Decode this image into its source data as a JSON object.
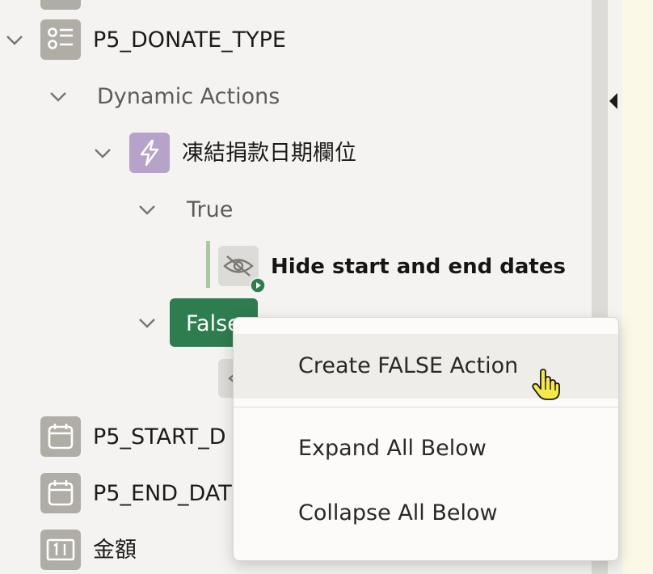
{
  "tree": {
    "item_type": {
      "label": "P5_DONATE_TYPE",
      "icon": "radio-group-icon"
    },
    "dynamic_actions": {
      "label": "Dynamic Actions"
    },
    "da_event": {
      "label": "凍結捐款日期欄位",
      "icon": "lightning-icon"
    },
    "true_branch": {
      "label": "True"
    },
    "hide_action": {
      "label": "Hide start and end dates",
      "icon": "eye-slash-icon"
    },
    "false_branch": {
      "label": "False"
    },
    "start_date": {
      "label": "P5_START_D",
      "icon": "calendar-icon"
    },
    "end_date": {
      "label": "P5_END_DAT",
      "icon": "calendar-icon"
    },
    "amount": {
      "label": "金額",
      "icon": "number-field-icon"
    }
  },
  "context_menu": {
    "items": [
      {
        "label": "Create FALSE Action"
      },
      {
        "label": "Expand All Below"
      },
      {
        "label": "Collapse All Below"
      }
    ]
  },
  "colors": {
    "selected_node": "#2e7d4f",
    "da_icon": "#b7a2c9",
    "item_icon": "#b0aca6",
    "panel_bg": "#f4f3f1"
  }
}
